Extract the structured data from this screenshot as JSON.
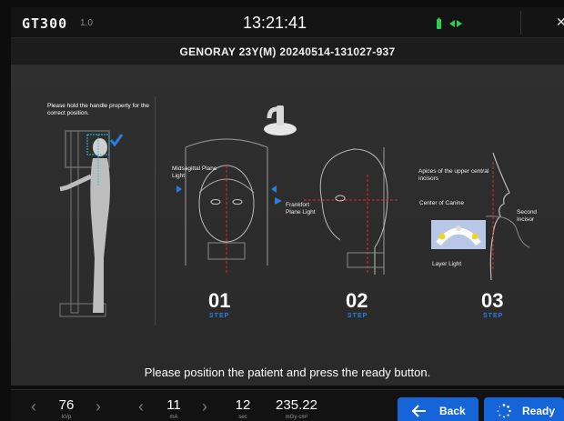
{
  "app": {
    "logo": "GT300",
    "version": "1.0",
    "clock": "13:21:41"
  },
  "patient_bar": {
    "text": "GENORAY   23Y(M)  20240514-131027-937"
  },
  "guide": {
    "hold_note": "Please hold the handle property for the correct position.",
    "midsagittal_label": "Midsagittal Plane Light",
    "frankfort_label": "Frankfort Plane Light",
    "apices_label": "Apices of the upper central incisors",
    "canine_label": "Center of Canine",
    "second_incisor_label": "Second Incisor",
    "layer_light_label": "Layer Light",
    "steps": [
      {
        "number": "01",
        "word": "STEP"
      },
      {
        "number": "02",
        "word": "STEP"
      },
      {
        "number": "03",
        "word": "STEP"
      }
    ],
    "instruction": "Please position the patient and press the ready button."
  },
  "params": {
    "kvp": {
      "value": "76",
      "unit": "kVp"
    },
    "ma": {
      "value": "11",
      "unit": "mA"
    },
    "sec": {
      "value": "12",
      "unit": "sec"
    },
    "dose": {
      "value": "235.22",
      "unit": "mGy·cm²"
    }
  },
  "buttons": {
    "back": "Back",
    "ready": "Ready"
  },
  "colors": {
    "accent": "#1565d8",
    "step_blue": "#2a7de1",
    "guide_cyan": "#27c2d8",
    "laser_red": "#e0282e",
    "status_green": "#2bd14a"
  },
  "icons": [
    "left-arrow-icon",
    "spinner-icon",
    "battery-icon",
    "network-icon",
    "close-icon",
    "chevron-left-icon",
    "chevron-right-icon",
    "check-icon"
  ]
}
